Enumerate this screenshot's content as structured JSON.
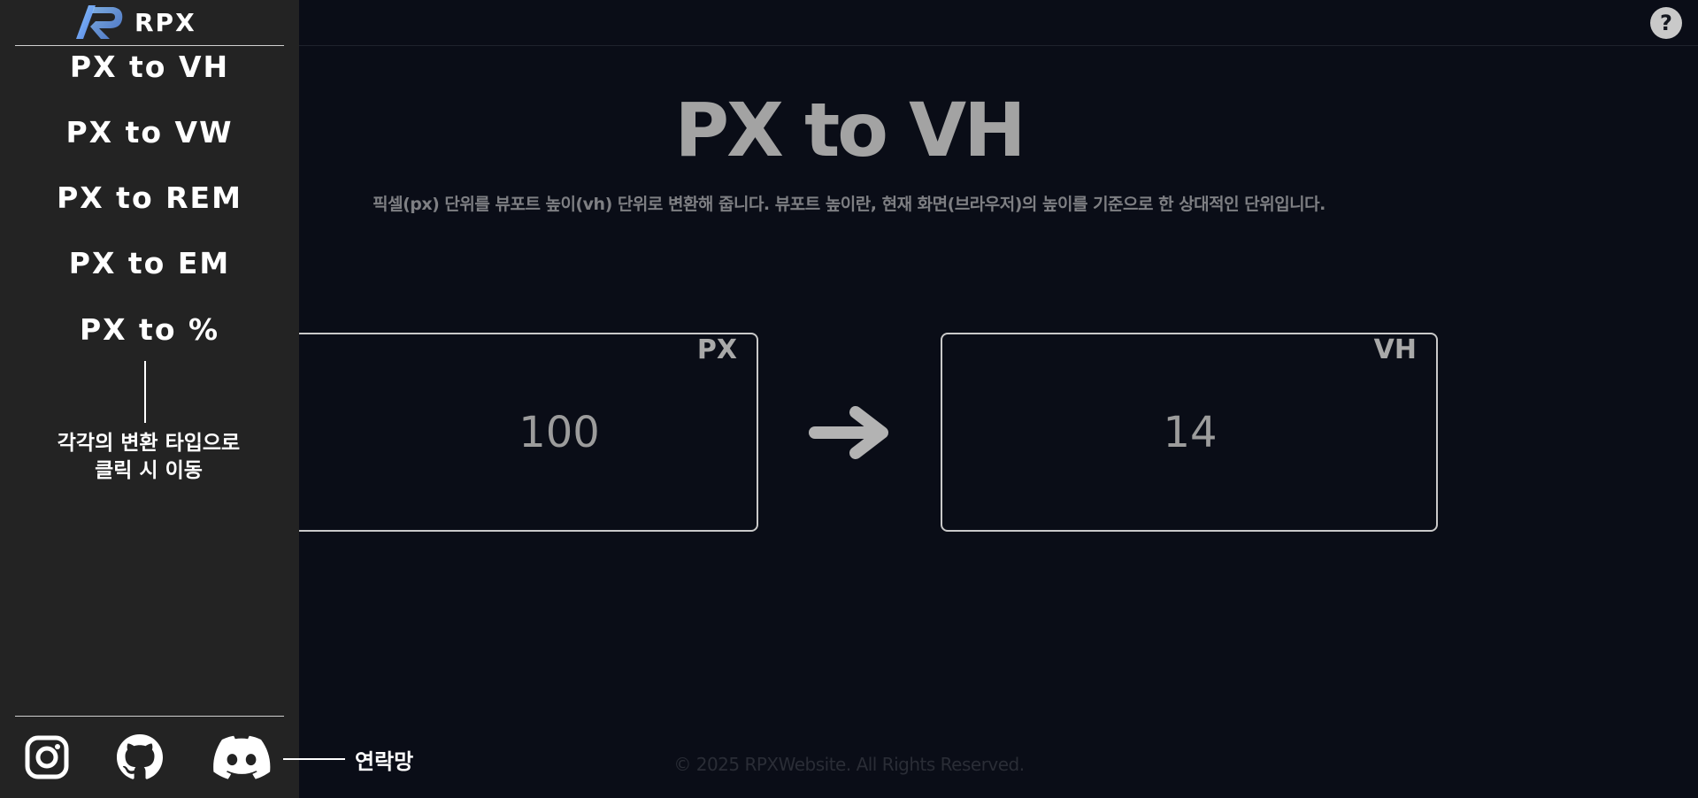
{
  "brand": {
    "name": "RPX"
  },
  "header": {
    "help_label": "?"
  },
  "nav": {
    "items": [
      {
        "label": "PX to VH"
      },
      {
        "label": "PX to VW"
      },
      {
        "label": "PX to REM"
      },
      {
        "label": "PX to EM"
      },
      {
        "label": "PX to %"
      }
    ]
  },
  "annotations": {
    "nav_note": "각각의 변환 타입으로\n클릭 시 이동",
    "contact_note": "연락망"
  },
  "main": {
    "title": "PX to VH",
    "description": "픽셀(px) 단위를 뷰포트 높이(vh) 단위로 변환해 줍니다. 뷰포트 높이란, 현재 화면(브라우저)의 높이를 기준으로 한 상대적인 단위입니다.",
    "input": {
      "value": "100",
      "unit": "PX"
    },
    "output": {
      "value": "14",
      "unit": "VH"
    }
  },
  "footer": {
    "text": "© 2025 RPXWebsite. All Rights Reserved."
  },
  "social": {
    "icons": [
      "instagram-icon",
      "github-icon",
      "discord-icon"
    ]
  },
  "colors": {
    "background": "#0a0d17",
    "sidebar": "#232323",
    "title": "#a3a3a3",
    "accent_logo": "#6aa4f2"
  }
}
